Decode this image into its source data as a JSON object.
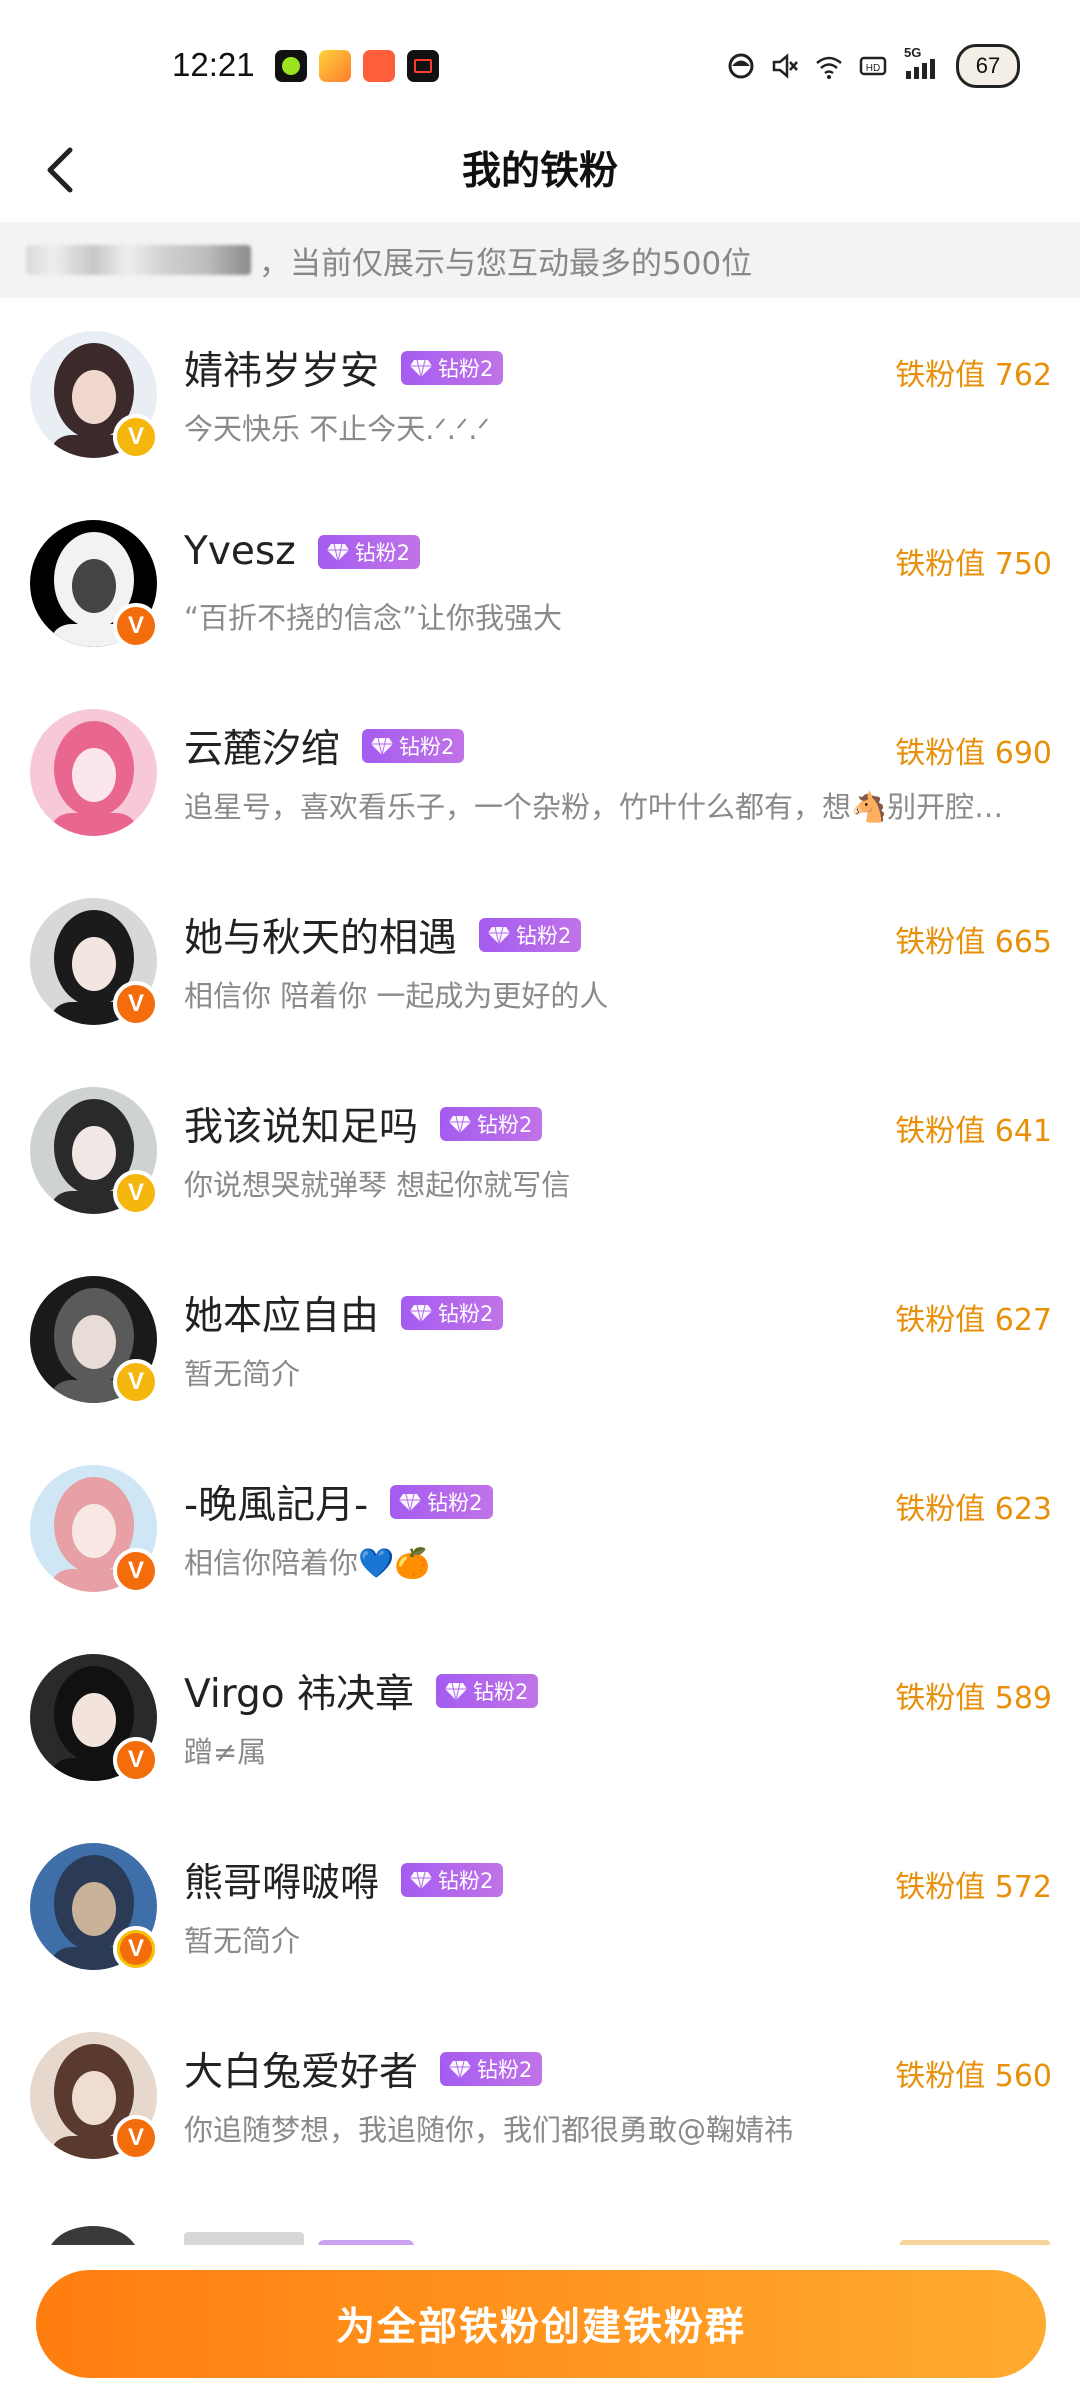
{
  "status_bar": {
    "time": "12:21",
    "network": "5G",
    "battery": "67",
    "app_icons": [
      "green-app-icon",
      "video-app-icon",
      "orange-app-icon",
      "record-app-icon"
    ]
  },
  "header": {
    "title": "我的铁粉",
    "back_icon": "chevron-left-icon"
  },
  "notice": {
    "text": "，当前仅展示与您互动最多的500位"
  },
  "fans": [
    {
      "name": "婧祎岁岁安",
      "tag": "钻粉2",
      "bio": "今天快乐 不止今天.ᐟ.ᐟ.ᐟ",
      "score": "铁粉值 762",
      "badge": "gold",
      "avatar_colors": [
        "#e9eef5",
        "#3c2a2a",
        "#f1d8cf"
      ]
    },
    {
      "name": "Yvesz",
      "tag": "钻粉2",
      "bio": "“百折不挠的信念”让你我强大",
      "score": "铁粉值 750",
      "badge": "orange",
      "avatar_colors": [
        "#000000",
        "#f2f2f2",
        "#444444"
      ]
    },
    {
      "name": "云麓汐绾",
      "tag": "钻粉2",
      "bio": "追星号，喜欢看乐子，一个杂粉，竹叶什么都有，想🐴别开腔…",
      "score": "铁粉值 690",
      "badge": "none",
      "avatar_colors": [
        "#f7c8d8",
        "#e9678f",
        "#fbe6ee"
      ]
    },
    {
      "name": "她与秋天的相遇",
      "tag": "钻粉2",
      "bio": "相信你 陪着你 一起成为更好的人",
      "score": "铁粉值 665",
      "badge": "orange",
      "avatar_colors": [
        "#d8d8d8",
        "#1b1b1b",
        "#f3e5e0"
      ]
    },
    {
      "name": "我该说知足吗",
      "tag": "钻粉2",
      "bio": "你说想哭就弹琴 想起你就写信",
      "score": "铁粉值 641",
      "badge": "gold",
      "avatar_colors": [
        "#cfd3cf",
        "#2a2a2a",
        "#f1e7e4"
      ]
    },
    {
      "name": "她本应自由",
      "tag": "钻粉2",
      "bio": "暂无简介",
      "score": "铁粉值 627",
      "badge": "gold",
      "avatar_colors": [
        "#1a1a1a",
        "#5a5a5a",
        "#e8dcd6"
      ]
    },
    {
      "name": "-晚風記月-",
      "tag": "钻粉2",
      "bio": "相信你陪着你💙🍊",
      "score": "铁粉值 623",
      "badge": "orange",
      "avatar_colors": [
        "#cfe6f4",
        "#e7a1a6",
        "#f7e8e4"
      ]
    },
    {
      "name": "Virgo 祎决章",
      "tag": "钻粉2",
      "bio": "蹭≠属",
      "score": "铁粉值 589",
      "badge": "orange",
      "avatar_colors": [
        "#2a2a2a",
        "#111111",
        "#f2e4dc"
      ]
    },
    {
      "name": "熊哥嘚啵嘚",
      "tag": "钻粉2",
      "bio": "暂无简介",
      "score": "铁粉值 572",
      "badge": "red",
      "avatar_colors": [
        "#3f6fa8",
        "#2b3b55",
        "#c9b19a"
      ]
    },
    {
      "name": "大白兔爱好者",
      "tag": "钻粉2",
      "bio": "你追随梦想，我追随你，我们都很勇敢@鞠婧祎",
      "score": "铁粉值 560",
      "badge": "orange",
      "avatar_colors": [
        "#e7d8cd",
        "#5a3a2e",
        "#f0ddd2"
      ]
    }
  ],
  "cta": {
    "label": "为全部铁粉创建铁粉群"
  },
  "colors": {
    "accent": "#ff8a1a",
    "score": "#e8900a",
    "tag": "#b36bec"
  }
}
